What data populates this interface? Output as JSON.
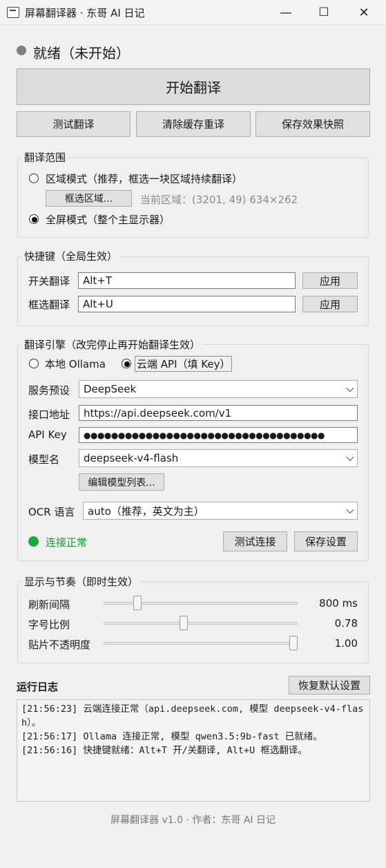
{
  "window": {
    "title": "屏幕翻译器 · 东哥 AI 日记",
    "minimize": "—",
    "maximize": "☐",
    "close": "✕"
  },
  "status": {
    "text": "就绪（未开始）",
    "dot_color": "#808080"
  },
  "main_actions": {
    "start": "开始翻译",
    "test": "测试翻译",
    "clear_cache": "清除缓存重译",
    "save_snapshot": "保存效果快照"
  },
  "scope": {
    "title": "翻译范围",
    "region_mode": "区域模式（推荐，框选一块区域持续翻译）",
    "select_region": "框选区域...",
    "current_region": "当前区域：(3201, 49) 634×262",
    "fullscreen_mode": "全屏模式（整个主显示器）",
    "selected": "fullscreen"
  },
  "hotkeys": {
    "title": "快捷键（全局生效）",
    "toggle_label": "开关翻译",
    "toggle_value": "Alt+T",
    "select_label": "框选翻译",
    "select_value": "Alt+U",
    "apply": "应用"
  },
  "engine": {
    "title": "翻译引擎（改完停止再开始翻译生效）",
    "local_option": "本地 Ollama",
    "cloud_option": "云端 API（填 Key）",
    "selected": "cloud",
    "preset_label": "服务预设",
    "preset_value": "DeepSeek",
    "endpoint_label": "接口地址",
    "endpoint_value": "https://api.deepseek.com/v1",
    "apikey_label": "API Key",
    "apikey_value": "●●●●●●●●●●●●●●●●●●●●●●●●●●●●●●●●●●●",
    "model_label": "模型名",
    "model_value": "deepseek-v4-flash",
    "edit_models": "编辑模型列表...",
    "ocr_label": "OCR 语言",
    "ocr_value": "auto（推荐，英文为主）",
    "connection_status": "连接正常",
    "connection_color": "#1aaa3a",
    "test_connection": "测试连接",
    "save_settings": "保存设置"
  },
  "display": {
    "title": "显示与节奏（即时生效）",
    "refresh_label": "刷新间隔",
    "refresh_value": "800 ms",
    "refresh_fraction": 0.16,
    "font_label": "字号比例",
    "font_value": "0.78",
    "font_fraction": 0.41,
    "opacity_label": "贴片不透明度",
    "opacity_value": "1.00",
    "opacity_fraction": 1.0
  },
  "log": {
    "title": "运行日志",
    "reset_button": "恢复默认设置",
    "lines": [
      "[21:56:23] 云端连接正常（api.deepseek.com, 模型 deepseek-v4-flash）。",
      "[21:56:17] Ollama 连接正常, 模型 qwen3.5:9b-fast 已就绪。",
      "[21:56:16] 快捷键就绪：Alt+T 开/关翻译, Alt+U 框选翻译。"
    ]
  },
  "footer": "屏幕翻译器 v1.0 · 作者：东哥 AI 日记"
}
